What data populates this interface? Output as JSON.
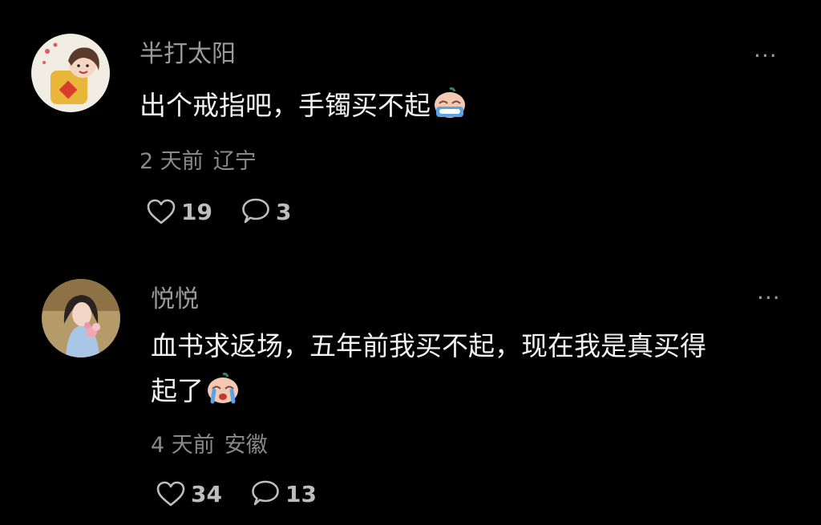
{
  "comments": [
    {
      "username": "半打太阳",
      "text_lines": [
        "出个戒指吧，手镯买不起"
      ],
      "emoji": "crying-face-icon",
      "time": "2 天前",
      "location": "辽宁",
      "likes": "19",
      "replies": "3"
    },
    {
      "username": "悦悦",
      "text_lines": [
        "血书求返场，五年前我买不起，现在我是真买得",
        "起了"
      ],
      "emoji": "crying-face-icon",
      "time": "4 天前",
      "location": "安徽",
      "likes": "34",
      "replies": "13"
    }
  ],
  "more_label": "···",
  "colors": {
    "background": "#000000",
    "username": "#9a9a9a",
    "body_text": "#f2f2f2",
    "meta": "#8a8a8a"
  }
}
